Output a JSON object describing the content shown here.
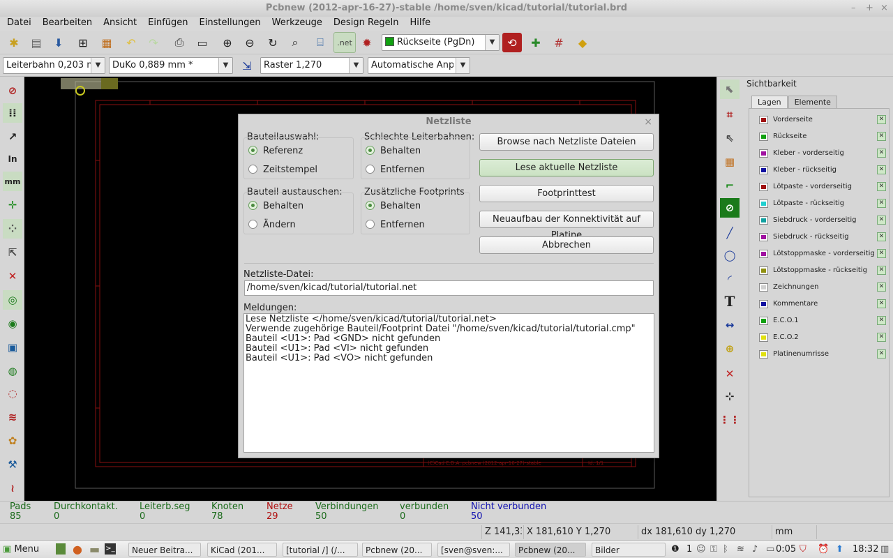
{
  "window": {
    "title": "Pcbnew (2012-apr-16-27)-stable /home/sven/kicad/tutorial/tutorial.brd",
    "controls": [
      "–",
      "+",
      "×"
    ]
  },
  "menu": [
    "Datei",
    "Bearbeiten",
    "Ansicht",
    "Einfügen",
    "Einstellungen",
    "Werkzeuge",
    "Design Regeln",
    "Hilfe"
  ],
  "toolbar": {
    "layer_select": "Rückseite (PgDn)",
    "net_label": ".net"
  },
  "toolbar2": {
    "track_width": "Leiterbahn 0,203 mm",
    "via_size": "DuKo 0,889 mm *",
    "grid": "Raster 1,270",
    "zoom": "Automatische Anpassung"
  },
  "visibility": {
    "title": "Sichtbarkeit",
    "tabs": [
      "Lagen",
      "Elemente"
    ],
    "layers": [
      {
        "name": "Vorderseite",
        "color": "#a01010"
      },
      {
        "name": "Rückseite",
        "color": "#10a010"
      },
      {
        "name": "Kleber - vorderseitig",
        "color": "#a010a0"
      },
      {
        "name": "Kleber - rückseitig",
        "color": "#1010a0"
      },
      {
        "name": "Lötpaste - vorderseitig",
        "color": "#a01010"
      },
      {
        "name": "Lötpaste - rückseitig",
        "color": "#20d0d0"
      },
      {
        "name": "Siebdruck - vorderseitig",
        "color": "#10a0a0"
      },
      {
        "name": "Siebdruck - rückseitig",
        "color": "#a010a0"
      },
      {
        "name": "Lötstoppmaske - vorderseitig",
        "color": "#a010a0"
      },
      {
        "name": "Lötstoppmaske - rückseitig",
        "color": "#909010"
      },
      {
        "name": "Zeichnungen",
        "color": "#d0d0d0"
      },
      {
        "name": "Kommentare",
        "color": "#1010a0"
      },
      {
        "name": "E.C.O.1",
        "color": "#10a010"
      },
      {
        "name": "E.C.O.2",
        "color": "#e0e010"
      },
      {
        "name": "Platinenumrisse",
        "color": "#e0e010"
      }
    ]
  },
  "stats": [
    {
      "label": "Pads",
      "value": "85",
      "color": "#1a6a1a"
    },
    {
      "label": "Durchkontakt.",
      "value": "0",
      "color": "#1a6a1a"
    },
    {
      "label": "Leiterb.seg",
      "value": "0",
      "color": "#1a6a1a"
    },
    {
      "label": "Knoten",
      "value": "78",
      "color": "#1a6a1a"
    },
    {
      "label": "Netze",
      "value": "29",
      "color": "#b01010"
    },
    {
      "label": "Verbindungen",
      "value": "50",
      "color": "#1a6a1a"
    },
    {
      "label": "verbunden",
      "value": "0",
      "color": "#1a6a1a"
    },
    {
      "label": "Nicht verbunden",
      "value": "50",
      "color": "#1010b0"
    }
  ],
  "coords": {
    "z": "Z 141,33",
    "xy": "X 181,610  Y 1,270",
    "dxdy": "dx 181,610  dy 1,270",
    "unit": "mm"
  },
  "dialog": {
    "title": "Netzliste",
    "component_select": {
      "label": "Bauteilauswahl:",
      "options": [
        "Referenz",
        "Zeitstempel"
      ],
      "selected": 0
    },
    "bad_tracks": {
      "label": "Schlechte Leiterbahnen:",
      "options": [
        "Behalten",
        "Entfernen"
      ],
      "selected": 0
    },
    "exchange": {
      "label": "Bauteil austauschen:",
      "options": [
        "Behalten",
        "Ändern"
      ],
      "selected": 0
    },
    "extra_fp": {
      "label": "Zusätzliche Footprints",
      "options": [
        "Behalten",
        "Entfernen"
      ],
      "selected": 0
    },
    "buttons": [
      "Browse nach Netzliste Dateien",
      "Lese aktuelle Netzliste",
      "Footprinttest",
      "Neuaufbau der Konnektivität auf Platine",
      "Abbrechen"
    ],
    "file_label": "Netzliste-Datei:",
    "file_value": "/home/sven/kicad/tutorial/tutorial.net",
    "messages_label": "Meldungen:",
    "messages": [
      "Lese Netzliste </home/sven/kicad/tutorial/tutorial.net>",
      "Verwende zugehörige Bauteil/Footprint Datei \"/home/sven/kicad/tutorial/tutorial.cmp\"",
      "Bauteil <U1>: Pad <GND> nicht gefunden",
      "Bauteil <U1>: Pad <VI> nicht gefunden",
      "Bauteil <U1>: Pad <VO> nicht gefunden"
    ]
  },
  "canvas": {
    "titleblock": "(C)Cad E.D.A.  pcbnew (2012-apr-16-27)-stable",
    "sheet": "Id: 1/1"
  },
  "taskbar": {
    "menu": "Menu",
    "tasks": [
      "Neuer Beitra...",
      "KiCad (201...",
      "[tutorial /] (/...",
      "Pcbnew (20...",
      "[sven@sven:...",
      "Pcbnew (20...",
      "Bilder"
    ],
    "tray_count": "1",
    "battery": "0:05",
    "clock": "18:32"
  }
}
